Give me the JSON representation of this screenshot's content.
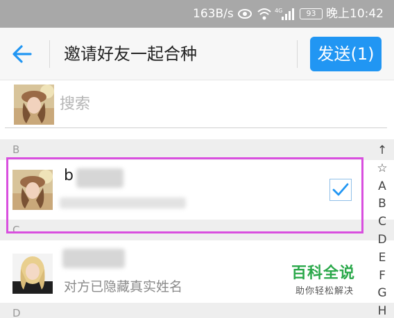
{
  "status_bar": {
    "speed": "163B/s",
    "battery": "93",
    "time": "晚上10:42",
    "icons": [
      "eye-icon",
      "wifi-icon",
      "4g-signal-icon",
      "battery-icon"
    ]
  },
  "header": {
    "title": "邀请好友一起合种",
    "send_label": "发送(1)",
    "accent": "#2196f3"
  },
  "search": {
    "placeholder": "搜索"
  },
  "sections": [
    {
      "letter": "B"
    },
    {
      "letter": "C"
    },
    {
      "letter": "D"
    }
  ],
  "contacts": [
    {
      "name": "b",
      "subtitle": "",
      "checked": true
    },
    {
      "name": "",
      "subtitle": "对方已隐藏真实姓名",
      "checked": false
    }
  ],
  "index_bar": [
    "↑",
    "☆",
    "A",
    "B",
    "C",
    "D",
    "E",
    "F",
    "G",
    "H"
  ],
  "watermark": {
    "title": "百科全说",
    "subtitle": "助你轻松解决"
  }
}
